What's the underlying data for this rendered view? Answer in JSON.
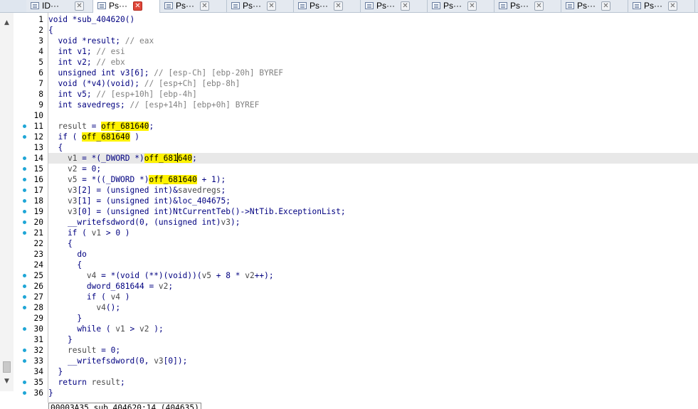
{
  "tabs": [
    {
      "label": "ID···",
      "active": false
    },
    {
      "label": "Ps···",
      "active": true
    },
    {
      "label": "Ps···",
      "active": false
    },
    {
      "label": "Ps···",
      "active": false
    },
    {
      "label": "Ps···",
      "active": false
    },
    {
      "label": "Ps···",
      "active": false
    },
    {
      "label": "Ps···",
      "active": false
    },
    {
      "label": "Ps···",
      "active": false
    },
    {
      "label": "Ps···",
      "active": false
    },
    {
      "label": "Ps···",
      "active": false
    }
  ],
  "scrollbar": {
    "up_arrow": "▲",
    "down_arrow": "▼"
  },
  "current_line": 14,
  "lines": [
    {
      "n": "1",
      "dot": false,
      "parts": [
        [
          "void *sub_404620()",
          "kw"
        ]
      ]
    },
    {
      "n": "2",
      "dot": false,
      "parts": [
        [
          "{",
          "kw"
        ]
      ]
    },
    {
      "n": "3",
      "dot": false,
      "parts": [
        [
          "  void *result; ",
          "kw"
        ],
        [
          "// eax",
          "cm"
        ]
      ]
    },
    {
      "n": "4",
      "dot": false,
      "parts": [
        [
          "  int v1; ",
          "kw"
        ],
        [
          "// esi",
          "cm"
        ]
      ]
    },
    {
      "n": "5",
      "dot": false,
      "parts": [
        [
          "  int v2; ",
          "kw"
        ],
        [
          "// ebx",
          "cm"
        ]
      ]
    },
    {
      "n": "6",
      "dot": false,
      "parts": [
        [
          "  unsigned int v3[6]; ",
          "kw"
        ],
        [
          "// [esp-Ch] [ebp-20h] BYREF",
          "cm"
        ]
      ]
    },
    {
      "n": "7",
      "dot": false,
      "parts": [
        [
          "  void (*v4)(void); ",
          "kw"
        ],
        [
          "// [esp+Ch] [ebp-8h]",
          "cm"
        ]
      ]
    },
    {
      "n": "8",
      "dot": false,
      "parts": [
        [
          "  int v5; ",
          "kw"
        ],
        [
          "// [esp+10h] [ebp-4h]",
          "cm"
        ]
      ]
    },
    {
      "n": "9",
      "dot": false,
      "parts": [
        [
          "  int savedregs; ",
          "kw"
        ],
        [
          "// [esp+14h] [ebp+0h] BYREF",
          "cm"
        ]
      ]
    },
    {
      "n": "10",
      "dot": false,
      "parts": [
        [
          "",
          "kw"
        ]
      ]
    },
    {
      "n": "11",
      "dot": true,
      "parts": [
        [
          "  ",
          "kw"
        ],
        [
          "result",
          "var"
        ],
        [
          " = ",
          "kw"
        ],
        [
          "off_681640",
          "hl"
        ],
        [
          ";",
          "kw"
        ]
      ]
    },
    {
      "n": "12",
      "dot": true,
      "parts": [
        [
          "  if ( ",
          "kw"
        ],
        [
          "off_681640",
          "hl"
        ],
        [
          " )",
          "kw"
        ]
      ]
    },
    {
      "n": "13",
      "dot": false,
      "parts": [
        [
          "  {",
          "kw"
        ]
      ]
    },
    {
      "n": "14",
      "dot": true,
      "parts": [
        [
          "    ",
          "kw"
        ],
        [
          "v1",
          "var"
        ],
        [
          " = *(_DWORD *)",
          "kw"
        ],
        [
          "off_681",
          "hl"
        ],
        [
          "|",
          "caret"
        ],
        [
          "640",
          "hl"
        ],
        [
          ";",
          "kw"
        ]
      ]
    },
    {
      "n": "15",
      "dot": true,
      "parts": [
        [
          "    ",
          "kw"
        ],
        [
          "v2",
          "var"
        ],
        [
          " = 0;",
          "kw"
        ]
      ]
    },
    {
      "n": "16",
      "dot": true,
      "parts": [
        [
          "    ",
          "kw"
        ],
        [
          "v5",
          "var"
        ],
        [
          " = *((_DWORD *)",
          "kw"
        ],
        [
          "off_681640",
          "hl"
        ],
        [
          " + 1);",
          "kw"
        ]
      ]
    },
    {
      "n": "17",
      "dot": true,
      "parts": [
        [
          "    ",
          "kw"
        ],
        [
          "v3",
          "var"
        ],
        [
          "[2] = (unsigned int)&",
          "kw"
        ],
        [
          "savedregs",
          "var"
        ],
        [
          ";",
          "kw"
        ]
      ]
    },
    {
      "n": "18",
      "dot": true,
      "parts": [
        [
          "    ",
          "kw"
        ],
        [
          "v3",
          "var"
        ],
        [
          "[1] = (unsigned int)&loc_404675;",
          "kw"
        ]
      ]
    },
    {
      "n": "19",
      "dot": true,
      "parts": [
        [
          "    ",
          "kw"
        ],
        [
          "v3",
          "var"
        ],
        [
          "[0] = (unsigned int)NtCurrentTeb()->NtTib.ExceptionList;",
          "kw"
        ]
      ]
    },
    {
      "n": "20",
      "dot": true,
      "parts": [
        [
          "    __writefsdword(0, (unsigned int)",
          "kw"
        ],
        [
          "v3",
          "var"
        ],
        [
          ");",
          "kw"
        ]
      ]
    },
    {
      "n": "21",
      "dot": true,
      "parts": [
        [
          "    if ( ",
          "kw"
        ],
        [
          "v1",
          "var"
        ],
        [
          " > 0 )",
          "kw"
        ]
      ]
    },
    {
      "n": "22",
      "dot": false,
      "parts": [
        [
          "    {",
          "kw"
        ]
      ]
    },
    {
      "n": "23",
      "dot": false,
      "parts": [
        [
          "      do",
          "kw"
        ]
      ]
    },
    {
      "n": "24",
      "dot": false,
      "parts": [
        [
          "      {",
          "kw"
        ]
      ]
    },
    {
      "n": "25",
      "dot": true,
      "parts": [
        [
          "        ",
          "kw"
        ],
        [
          "v4",
          "var"
        ],
        [
          " = *(void (**)(void))(",
          "kw"
        ],
        [
          "v5",
          "var"
        ],
        [
          " + 8 * ",
          "kw"
        ],
        [
          "v2",
          "var"
        ],
        [
          "++);",
          "kw"
        ]
      ]
    },
    {
      "n": "26",
      "dot": true,
      "parts": [
        [
          "        dword_681644 = ",
          "kw"
        ],
        [
          "v2",
          "var"
        ],
        [
          ";",
          "kw"
        ]
      ]
    },
    {
      "n": "27",
      "dot": true,
      "parts": [
        [
          "        if ( ",
          "kw"
        ],
        [
          "v4",
          "var"
        ],
        [
          " )",
          "kw"
        ]
      ]
    },
    {
      "n": "28",
      "dot": true,
      "parts": [
        [
          "          ",
          "kw"
        ],
        [
          "v4",
          "var"
        ],
        [
          "();",
          "kw"
        ]
      ]
    },
    {
      "n": "29",
      "dot": false,
      "parts": [
        [
          "      }",
          "kw"
        ]
      ]
    },
    {
      "n": "30",
      "dot": true,
      "parts": [
        [
          "      while ( ",
          "kw"
        ],
        [
          "v1",
          "var"
        ],
        [
          " > ",
          "kw"
        ],
        [
          "v2",
          "var"
        ],
        [
          " );",
          "kw"
        ]
      ]
    },
    {
      "n": "31",
      "dot": false,
      "parts": [
        [
          "    }",
          "kw"
        ]
      ]
    },
    {
      "n": "32",
      "dot": true,
      "parts": [
        [
          "    ",
          "kw"
        ],
        [
          "result",
          "var"
        ],
        [
          " = 0;",
          "kw"
        ]
      ]
    },
    {
      "n": "33",
      "dot": true,
      "parts": [
        [
          "    __writefsdword(0, ",
          "kw"
        ],
        [
          "v3",
          "var"
        ],
        [
          "[0]);",
          "kw"
        ]
      ]
    },
    {
      "n": "34",
      "dot": false,
      "parts": [
        [
          "  }",
          "kw"
        ]
      ]
    },
    {
      "n": "35",
      "dot": true,
      "parts": [
        [
          "  return ",
          "kw"
        ],
        [
          "result",
          "var"
        ],
        [
          ";",
          "kw"
        ]
      ]
    },
    {
      "n": "36",
      "dot": true,
      "parts": [
        [
          "}",
          "kw"
        ]
      ]
    }
  ],
  "status": {
    "text": "00003A35 sub_404620:14 (404635)"
  },
  "colors": {
    "highlight": "#fff200",
    "breakpoint_dot": "#1fa6d6",
    "code": "#000080",
    "comment": "#808080"
  }
}
